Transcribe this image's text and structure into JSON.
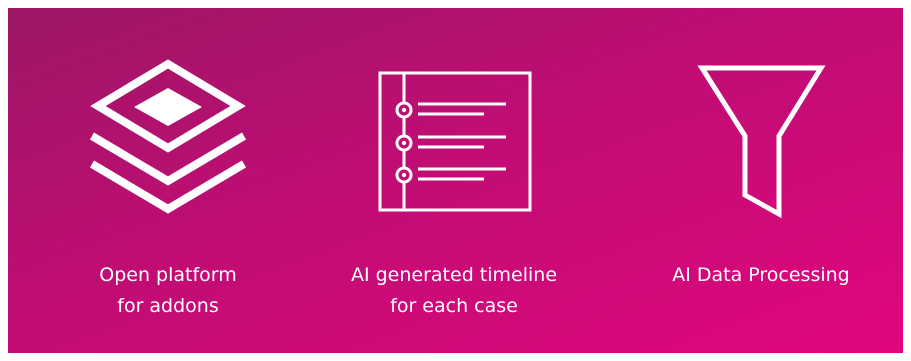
{
  "features": [
    {
      "icon": "layers-icon",
      "label_line1": "Open platform",
      "label_line2": "for addons"
    },
    {
      "icon": "timeline-icon",
      "label_line1": "AI generated timeline",
      "label_line2": "for each case"
    },
    {
      "icon": "funnel-icon",
      "label_line1": "AI Data Processing",
      "label_line2": ""
    }
  ],
  "colors": {
    "gradient_start": "#9c1765",
    "gradient_mid": "#c00d74",
    "gradient_end": "#e0067e",
    "foreground": "#ffffff"
  }
}
